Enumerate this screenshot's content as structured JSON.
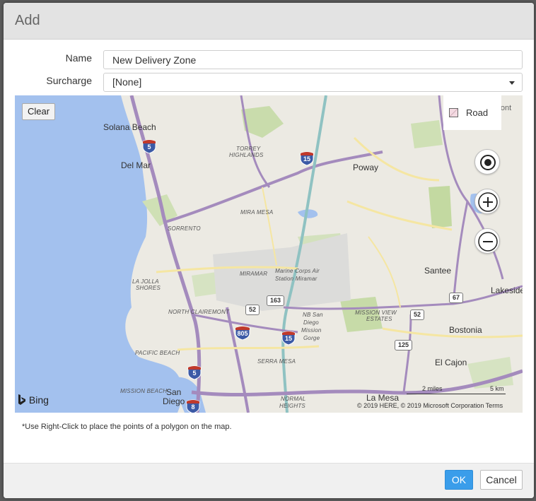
{
  "dialog": {
    "title": "Add"
  },
  "form": {
    "name_label": "Name",
    "name_value": "New Delivery Zone",
    "surcharge_label": "Surcharge",
    "surcharge_value": "[None]"
  },
  "map": {
    "clear_label": "Clear",
    "layer_label": "Road",
    "layer_partial_label": "Rosemont",
    "places": {
      "solana_beach": "Solana Beach",
      "del_mar": "Del Mar",
      "poway": "Poway",
      "torrey_highlands_1": "TORREY",
      "torrey_highlands_2": "HIGHLANDS",
      "mira_mesa": "MIRA MESA",
      "sorrento": "SORRENTO",
      "miramar": "MIRAMAR",
      "mcas_1": "Marine Corps Air",
      "mcas_2": "Station Miramar",
      "santee": "Santee",
      "lakeside": "Lakeside",
      "la_jolla_1": "LA JOLLA",
      "la_jolla_2": "SHORES",
      "north_clairemont": "NORTH CLAIREMONT",
      "mission_view_1": "MISSION VIEW",
      "mission_view_2": "ESTATES",
      "bostonia": "Bostonia",
      "nb_san_1": "NB San",
      "nb_san_2": "Diego",
      "nb_san_3": "Mission",
      "nb_san_4": "Gorge",
      "pacific_beach": "PACIFIC BEACH",
      "serra_mesa": "SERRA MESA",
      "el_cajon": "El Cajon",
      "mission_beach": "MISSION BEACH",
      "san_diego_1": "San",
      "san_diego_2": "Diego",
      "normal_heights_1": "NORMAL",
      "normal_heights_2": "HEIGHTS",
      "la_mesa": "La Mesa"
    },
    "shields": {
      "i5_north": "5",
      "i15_north": "15",
      "i805": "805",
      "i15_south": "15",
      "i5_south": "5",
      "i8": "8",
      "r52_west": "52",
      "r163": "163",
      "r52_east": "52",
      "r67": "67",
      "r125": "125"
    },
    "scale_miles": "2 miles",
    "scale_km": "5 km",
    "attribution": "© 2019 HERE, © 2019 Microsoft Corporation  Terms",
    "brand": "Bing"
  },
  "hint": "*Use Right-Click to place the points of a polygon on the map.",
  "buttons": {
    "ok": "OK",
    "cancel": "Cancel"
  }
}
